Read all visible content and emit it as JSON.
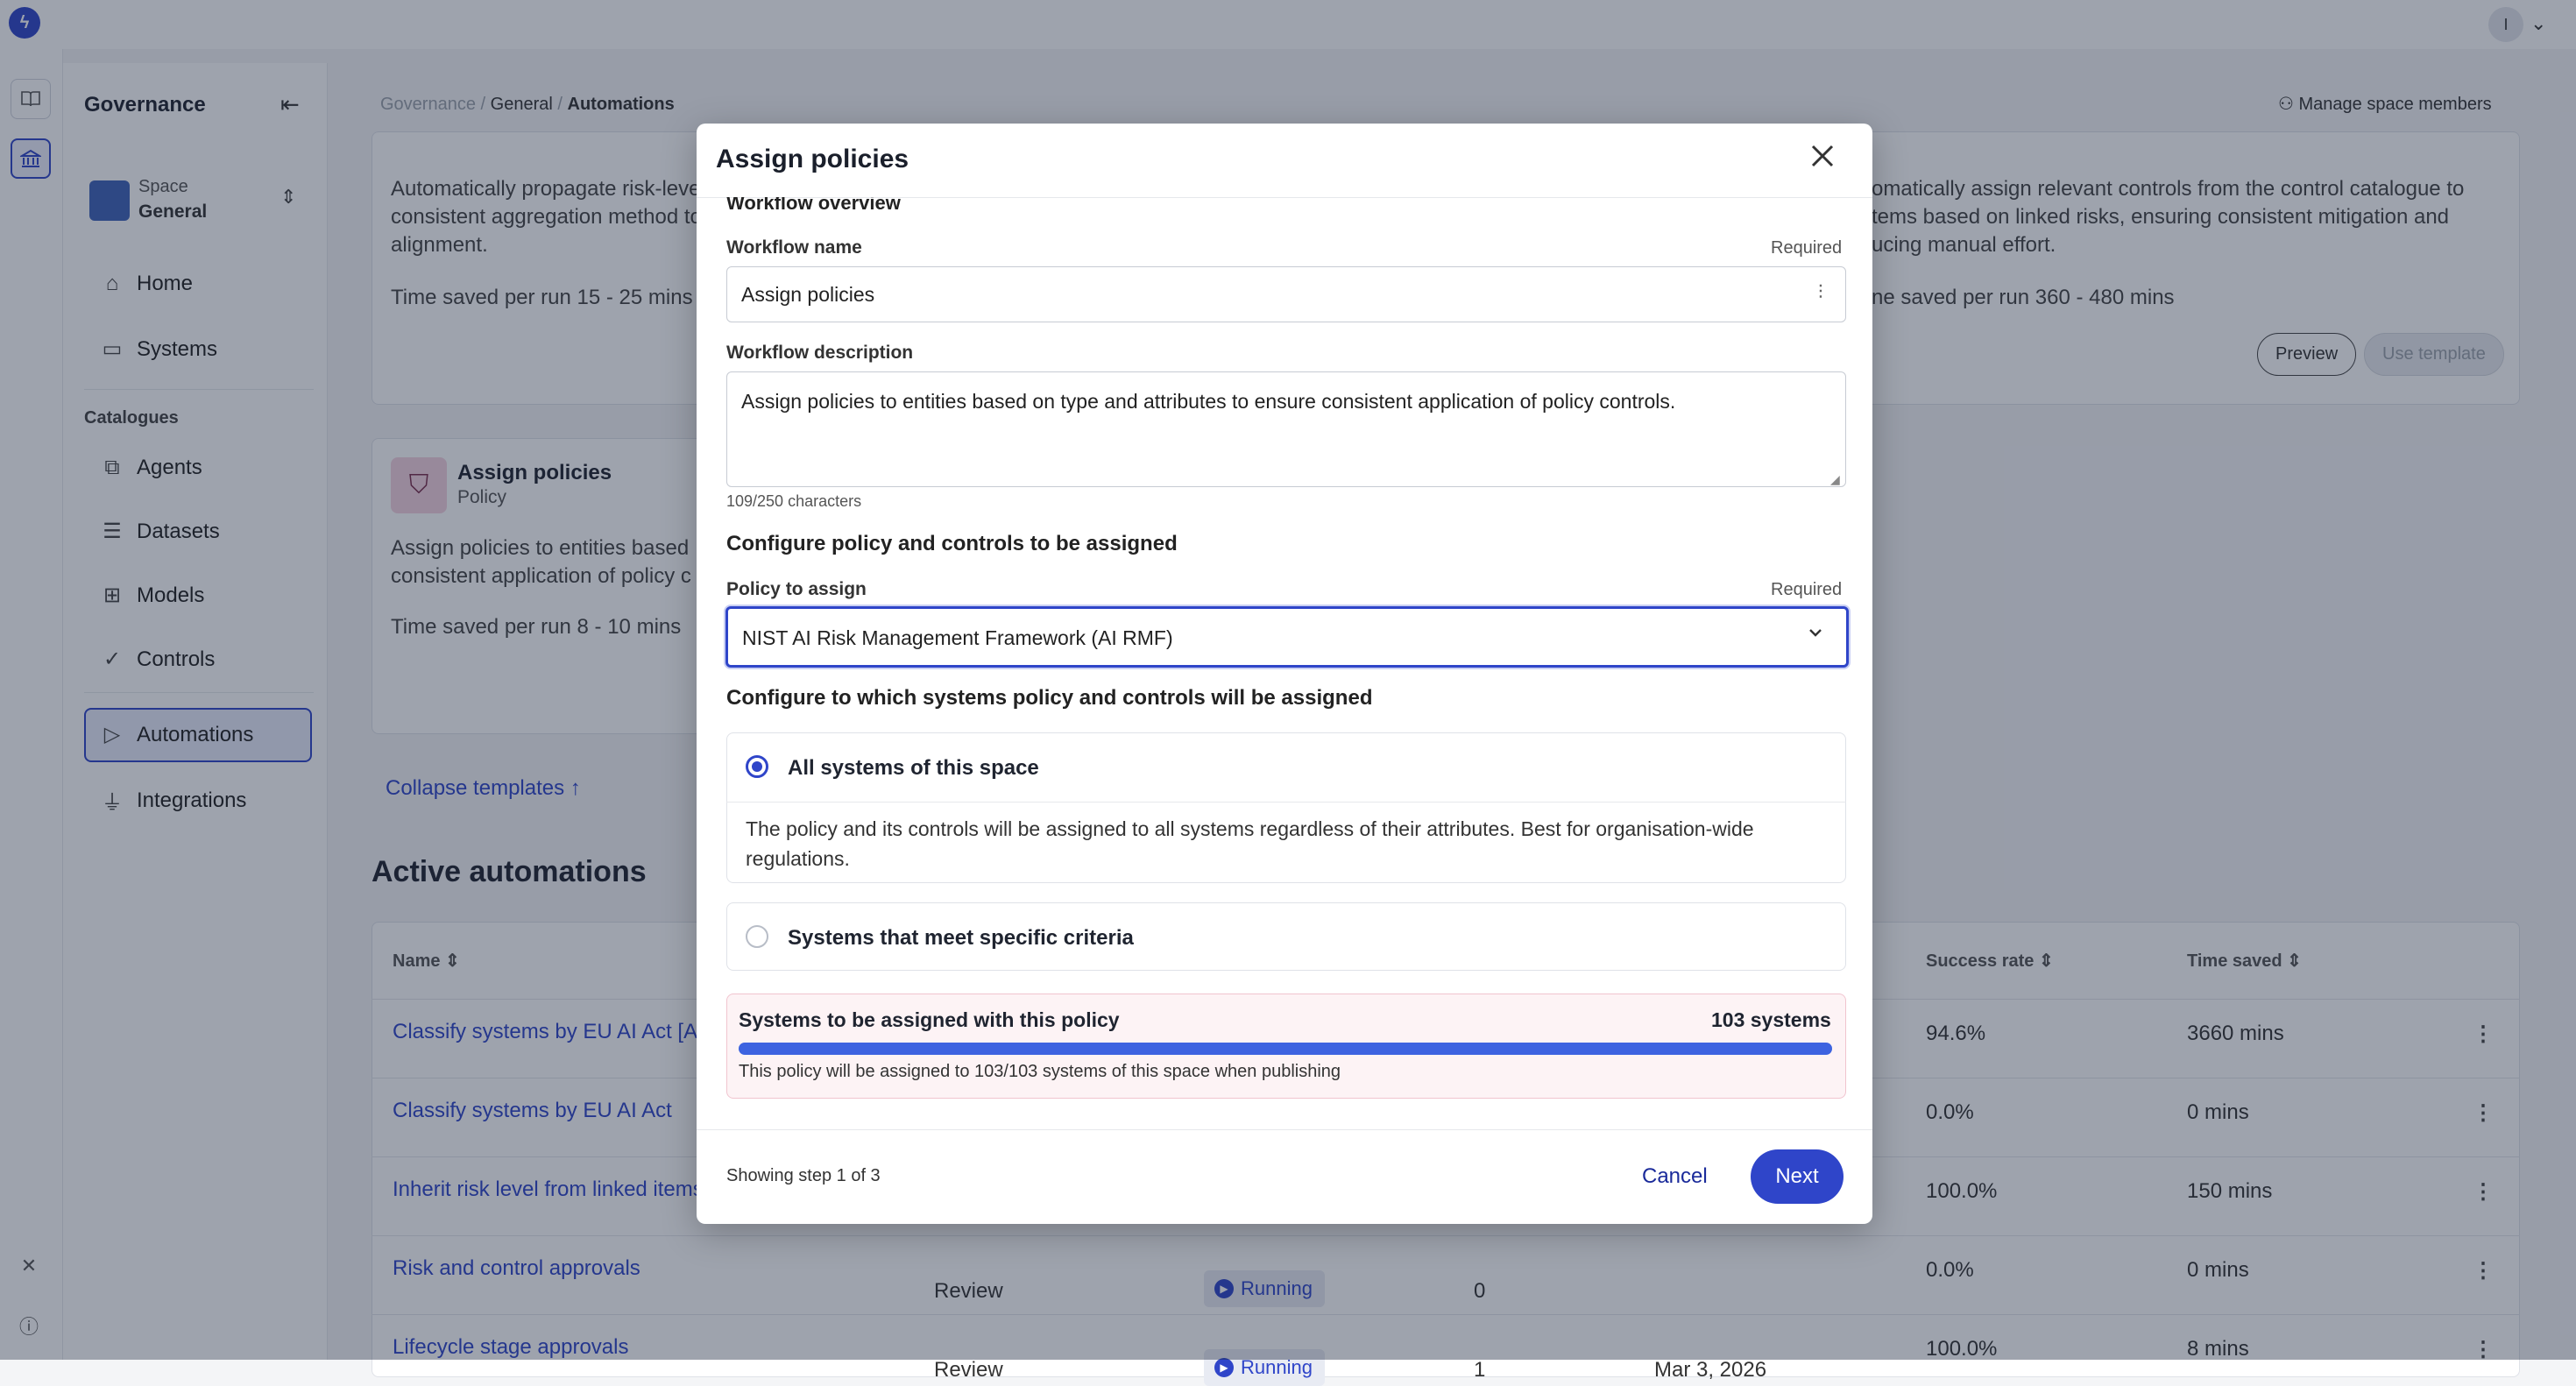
{
  "app": {
    "logo_icon": "bolt-icon",
    "avatar_initial": "I",
    "rail_icons": [
      "book-icon",
      "bank-icon"
    ],
    "rail_bottom_icons": [
      "tools-icon",
      "info-icon"
    ]
  },
  "sidebar": {
    "title": "Governance",
    "space_label": "Space",
    "space_name": "General",
    "items_top": [
      {
        "label": "Home",
        "icon": "home-icon"
      },
      {
        "label": "Systems",
        "icon": "systems-icon"
      }
    ],
    "section_label": "Catalogues",
    "items_catalogues": [
      {
        "label": "Agents",
        "icon": "agents-icon"
      },
      {
        "label": "Datasets",
        "icon": "datasets-icon"
      },
      {
        "label": "Models",
        "icon": "models-icon"
      },
      {
        "label": "Controls",
        "icon": "controls-icon"
      }
    ],
    "items_bottom": [
      {
        "label": "Automations",
        "icon": "play-icon",
        "active": true
      },
      {
        "label": "Integrations",
        "icon": "plug-icon"
      }
    ]
  },
  "header": {
    "breadcrumb_1": "Governance",
    "breadcrumb_sep": "/",
    "breadcrumb_2": "General",
    "breadcrumb_3": "Automations",
    "manage_members": "Manage space members"
  },
  "templates": {
    "card1_desc": "Automatically propagate risk-leve consistent aggregation method to alignment.",
    "card1_desc_l1": "Automatically propagate risk-leve",
    "card1_desc_l2": "consistent aggregation method to",
    "card1_desc_l3": "alignment.",
    "card1_time": "Time saved per run 15 - 25 mins",
    "card3_desc_l1": "omatically assign relevant controls from the control catalogue to",
    "card3_desc_l2": "tems based on linked risks, ensuring consistent mitigation and",
    "card3_desc_l3": "ucing manual effort.",
    "card3_time": "ne saved per run 360 - 480 mins",
    "preview_label": "Preview",
    "use_template_label": "Use template",
    "card2_title": "Assign policies",
    "card2_subtitle": "Policy",
    "card2_desc_l1": "Assign policies to entities based",
    "card2_desc_l2": "consistent application of policy c",
    "card2_time": "Time saved per run 8 - 10 mins",
    "collapse_label": "Collapse templates"
  },
  "active": {
    "title": "Active automations",
    "columns": {
      "name": "Name",
      "success_rate": "Success rate",
      "time_saved": "Time saved"
    },
    "rows": [
      {
        "name": "Classify systems by EU AI Act [A",
        "type": "",
        "status": "",
        "runs": "",
        "date": "",
        "rate": "94.6%",
        "saved": "3660 mins"
      },
      {
        "name": "Classify systems by EU AI Act",
        "type": "",
        "status": "",
        "runs": "",
        "date": "",
        "rate": "0.0%",
        "saved": "0 mins"
      },
      {
        "name": "Inherit risk level from linked items",
        "type": "",
        "status": "",
        "runs": "",
        "date": "",
        "rate": "100.0%",
        "saved": "150 mins"
      },
      {
        "name": "Risk and control approvals",
        "type": "Review",
        "status": "Running",
        "runs": "0",
        "date": "",
        "rate": "0.0%",
        "saved": "0 mins"
      },
      {
        "name": "Lifecycle stage approvals",
        "type": "Review",
        "status": "Running",
        "runs": "1",
        "date": "Mar 3, 2026",
        "rate": "100.0%",
        "saved": "8 mins"
      }
    ]
  },
  "modal": {
    "title": "Assign policies",
    "section_overview": "Workflow overview",
    "name_label": "Workflow name",
    "required": "Required",
    "name_value": "Assign policies",
    "desc_label": "Workflow description",
    "desc_value": "Assign policies to entities based on type and attributes to ensure consistent application of policy controls.",
    "char_count": "109/250 characters",
    "section_policy": "Configure policy and controls to be assigned",
    "policy_label": "Policy to assign",
    "policy_value": "NIST AI Risk Management Framework (AI RMF)",
    "section_systems": "Configure to which systems policy and controls will be assigned",
    "option_all_label": "All systems of this space",
    "option_all_desc_l1": "The policy and its controls will be assigned to all systems regardless of their attributes. Best for organisation-wide",
    "option_all_desc_l2": "regulations.",
    "option_criteria_label": "Systems that meet specific criteria",
    "assigned_label": "Systems to be assigned with this policy",
    "assigned_count": "103 systems",
    "assigned_progress": 1.0,
    "assigned_note": "This policy will be assigned to 103/103 systems of this space when publishing",
    "step_text": "Showing step 1 of 3",
    "cancel_label": "Cancel",
    "next_label": "Next",
    "accent_color": "#2f45c9"
  }
}
